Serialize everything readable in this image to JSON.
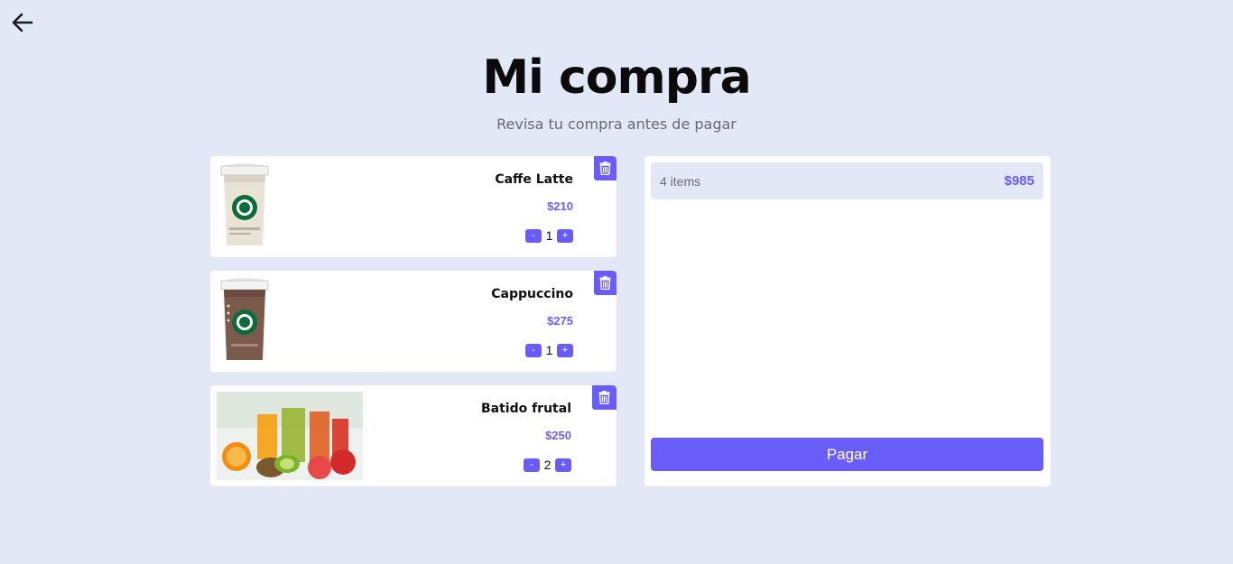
{
  "header": {
    "back_icon": "arrow-left-icon",
    "title": "Mi compra",
    "subtitle": "Revisa tu compra antes de pagar"
  },
  "cart": {
    "items": [
      {
        "name": "Caffe Latte",
        "price": "$210",
        "quantity": "1",
        "minus_label": "-",
        "plus_label": "+",
        "image": "caffe-latte-cup"
      },
      {
        "name": "Cappuccino",
        "price": "$275",
        "quantity": "1",
        "minus_label": "-",
        "plus_label": "+",
        "image": "cappuccino-cup"
      },
      {
        "name": "Batido frutal",
        "price": "$250",
        "quantity": "2",
        "minus_label": "-",
        "plus_label": "+",
        "image": "fruit-smoothie-photo"
      }
    ],
    "delete_icon": "trash-icon"
  },
  "summary": {
    "items_label": "4 items",
    "total": "$985",
    "pay_label": "Pagar"
  },
  "colors": {
    "background": "#e3e8f6",
    "accent": "#6a5cf6",
    "card": "#ffffff"
  }
}
